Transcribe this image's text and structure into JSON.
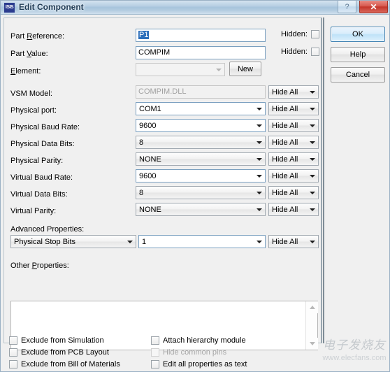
{
  "window": {
    "title": "Edit Component",
    "icon_label": "ISIS",
    "help_button": "?",
    "close_button": "✕"
  },
  "fields": {
    "part_reference": {
      "label_pre": "Part ",
      "label_key": "R",
      "label_post": "eference:",
      "label_full": "Part Reference:",
      "value": "P1",
      "hidden_label": "Hidden:",
      "hidden_checked": false
    },
    "part_value": {
      "label_pre": "Part ",
      "label_key": "V",
      "label_post": "alue:",
      "label_full": "Part Value:",
      "value": "COMPIM",
      "hidden_label": "Hidden:",
      "hidden_checked": false
    },
    "element": {
      "label_pre": "",
      "label_key": "E",
      "label_post": "lement:",
      "label_full": "Element:",
      "value": "",
      "new_button": "New"
    }
  },
  "properties": [
    {
      "label": "VSM Model:",
      "value": "COMPIM.DLL",
      "style": "readonly",
      "visibility": "Hide All"
    },
    {
      "label": "Physical port:",
      "value": "COM1",
      "style": "white",
      "visibility": "Hide All"
    },
    {
      "label": "Physical Baud Rate:",
      "value": "9600",
      "style": "white",
      "visibility": "Hide All"
    },
    {
      "label": "Physical Data Bits:",
      "value": "8",
      "style": "grey",
      "visibility": "Hide All"
    },
    {
      "label": "Physical Parity:",
      "value": "NONE",
      "style": "grey",
      "visibility": "Hide All"
    },
    {
      "label": "Virtual Baud Rate:",
      "value": "9600",
      "style": "white",
      "visibility": "Hide All"
    },
    {
      "label": "Virtual Data Bits:",
      "value": "8",
      "style": "grey",
      "visibility": "Hide All"
    },
    {
      "label": "Virtual Parity:",
      "value": "NONE",
      "style": "grey",
      "visibility": "Hide All"
    }
  ],
  "advanced": {
    "label": "Advanced Properties:",
    "property_name": "Physical Stop Bits",
    "property_value": "1",
    "visibility": "Hide All"
  },
  "other_properties": {
    "label_pre": "Other ",
    "label_key": "P",
    "label_post": "roperties:",
    "label_full": "Other Properties:",
    "value": "",
    "scroll_up_icon": "triangle-up",
    "scroll_down_icon": "triangle-down"
  },
  "buttons": {
    "ok": "OK",
    "help": "Help",
    "cancel": "Cancel"
  },
  "checkboxes_left": [
    {
      "label": "Exclude from Simulation",
      "checked": false,
      "disabled": false
    },
    {
      "label": "Exclude from PCB Layout",
      "checked": false,
      "disabled": false
    },
    {
      "label": "Exclude from Bill of Materials",
      "checked": false,
      "disabled": false
    }
  ],
  "checkboxes_right": [
    {
      "label": "Attach hierarchy module",
      "checked": false,
      "disabled": false
    },
    {
      "label": "Hide common pins",
      "checked": false,
      "disabled": true
    },
    {
      "label": "Edit all properties as text",
      "checked": false,
      "disabled": false
    }
  ],
  "watermark": {
    "cn": "电子发烧友",
    "en": "www.elecfans.com"
  },
  "colors": {
    "titlebar_start": "#d3e2ef",
    "titlebar_end": "#cfe0ee",
    "close_button": "#c4362b",
    "focus_blue": "#3c7fb1",
    "selection_blue": "#2c6fbb",
    "panel_bg": "#f0f0f0"
  }
}
